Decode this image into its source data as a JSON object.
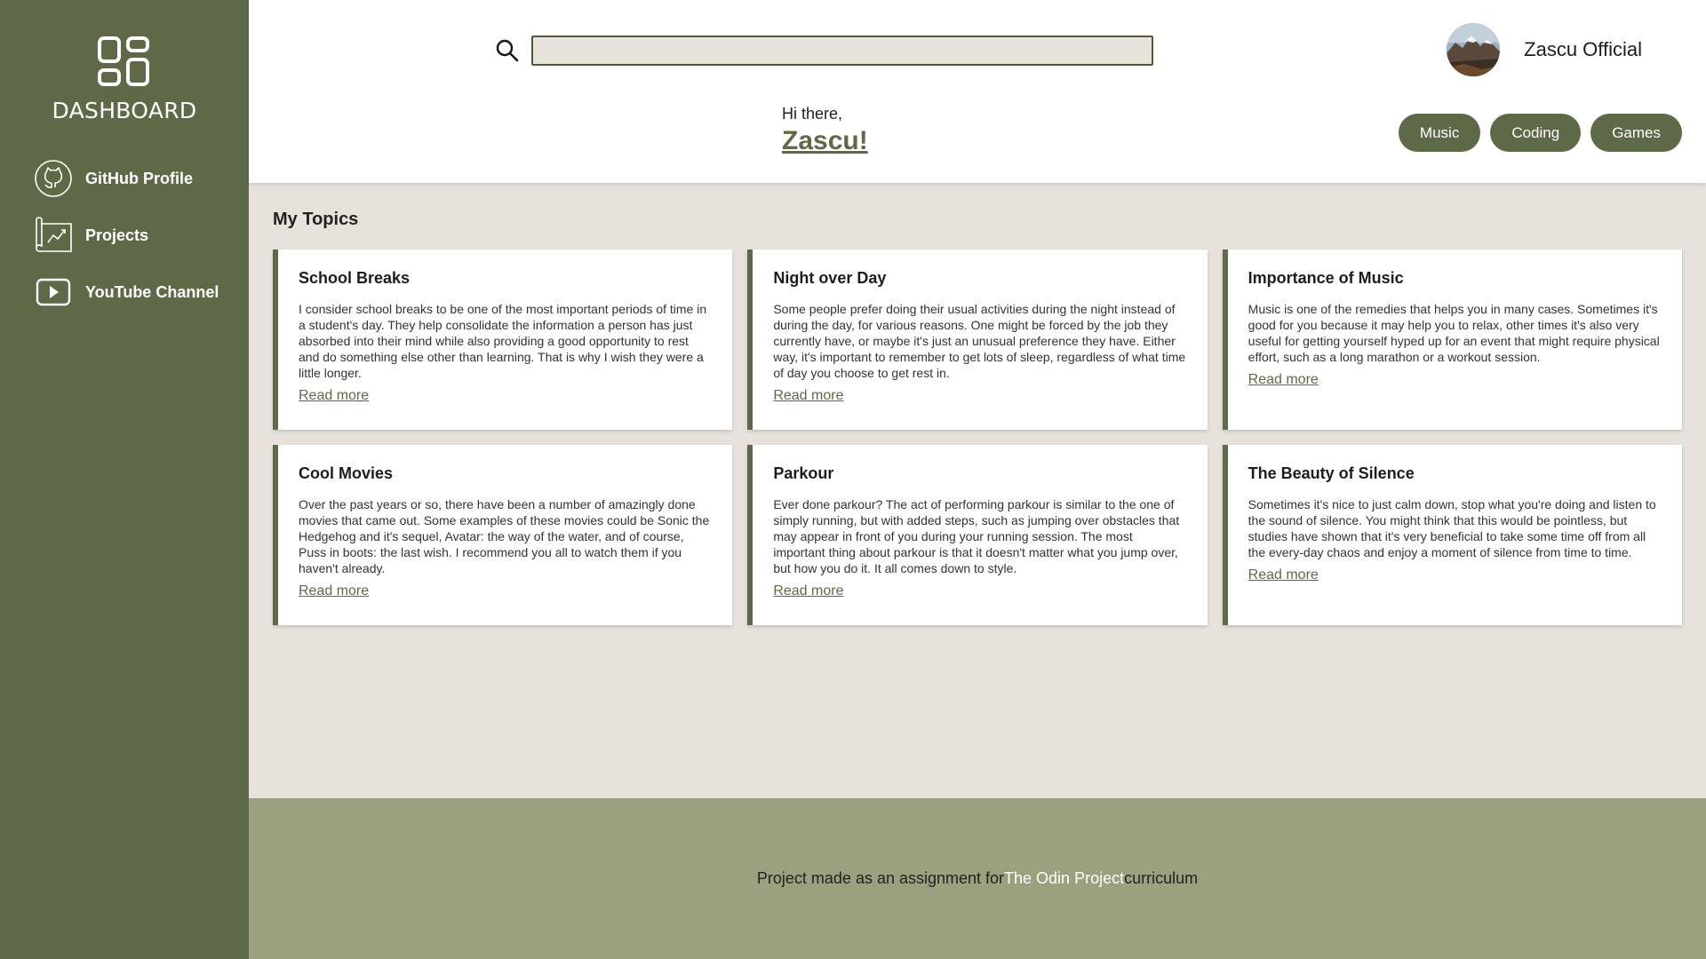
{
  "sidebar": {
    "brand_title": "DASHBOARD",
    "brand_icon": "dashboard-grid-icon",
    "items": [
      {
        "label": "GitHub Profile",
        "icon": "github-icon"
      },
      {
        "label": "Projects",
        "icon": "projects-chart-icon"
      },
      {
        "label": "YouTube Channel",
        "icon": "youtube-icon"
      }
    ]
  },
  "header": {
    "search": {
      "placeholder": "",
      "value": "",
      "icon": "search-icon"
    },
    "profile": {
      "name": "Zascu Official",
      "avatar": "mountain-landscape-avatar"
    },
    "greeting": {
      "small": "Hi there,",
      "name": "Zascu!"
    },
    "topics": [
      "Music",
      "Coding",
      "Games"
    ]
  },
  "main": {
    "section_title": "My Topics",
    "cards": [
      {
        "title": "School Breaks",
        "body": "I consider school breaks to be one of the most important periods of time in a student's day. They help consolidate the information a person has just absorbed into their mind while also providing a good opportunity to rest and do something else other than learning. That is why I wish they were a little longer.",
        "link": "Read more"
      },
      {
        "title": "Night over Day",
        "body": "Some people prefer doing their usual activities during the night instead of during the day, for various reasons. One might be forced by the job they currently have, or maybe it's just an unusual preference they have. Either way, it's important to remember to get lots of sleep, regardless of what time of day you choose to get rest in.",
        "link": "Read more"
      },
      {
        "title": "Importance of Music",
        "body": "Music is one of the remedies that helps you in many cases. Sometimes it's good for you because it may help you to relax, other times it's also very useful for getting yourself hyped up for an event that might require physical effort, such as a long marathon or a workout session.",
        "link": "Read more"
      },
      {
        "title": "Cool Movies",
        "body": "Over the past years or so, there have been a number of amazingly done movies that came out. Some examples of these movies could be Sonic the Hedgehog and it's sequel, Avatar: the way of the water, and of course, Puss in boots: the last wish. I recommend you all to watch them if you haven't already.",
        "link": "Read more"
      },
      {
        "title": "Parkour",
        "body": "Ever done parkour? The act of performing parkour is similar to the one of simply running, but with added steps, such as jumping over obstacles that may appear in front of you during your running session. The most important thing about parkour is that it doesn't matter what you jump over, but how you do it. It all comes down to style.",
        "link": "Read more"
      },
      {
        "title": "The Beauty of Silence",
        "body": "Sometimes it's nice to just calm down, stop what you're doing and listen to the sound of silence. You might think that this would be pointless, but studies have shown that it's very beneficial to take some time off from all the every-day chaos and enjoy a moment of silence from time to time.",
        "link": "Read more"
      }
    ]
  },
  "footer": {
    "text_before": "Project made as an assignment for ",
    "link": "The Odin Project",
    "text_after": " curriculum"
  },
  "colors": {
    "accent": "#5e6a47",
    "background": "#e7e3dc",
    "footer": "#9ba17e",
    "header": "#ffffff"
  }
}
